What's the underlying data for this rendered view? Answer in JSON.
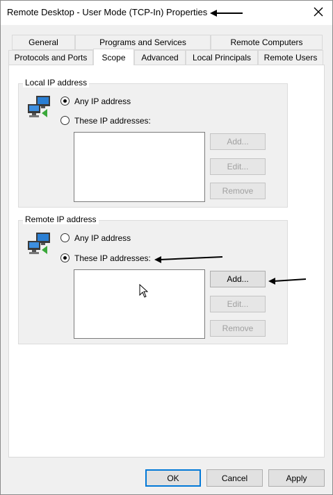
{
  "window": {
    "title": "Remote Desktop - User Mode (TCP-In) Properties",
    "close_icon": "close-icon"
  },
  "tabs": {
    "row_top": [
      "General",
      "Programs and Services",
      "Remote Computers"
    ],
    "row_bottom": [
      "Protocols and Ports",
      "Scope",
      "Advanced",
      "Local Principals",
      "Remote Users"
    ],
    "active": "Scope"
  },
  "local_ip": {
    "label": "Local IP address",
    "icon": "network-computers-icon",
    "option_any": "Any IP address",
    "option_these": "These IP addresses:",
    "selected": "any",
    "add": "Add...",
    "edit": "Edit...",
    "remove": "Remove"
  },
  "remote_ip": {
    "label": "Remote IP address",
    "icon": "network-computers-icon",
    "option_any": "Any IP address",
    "option_these": "These IP addresses:",
    "selected": "these",
    "add": "Add...",
    "edit": "Edit...",
    "remove": "Remove"
  },
  "footer": {
    "ok": "OK",
    "cancel": "Cancel",
    "apply": "Apply"
  },
  "colors": {
    "accent": "#0078d7",
    "disabled_text": "#a0a0a0",
    "window_bg": "#f0f0f0"
  }
}
